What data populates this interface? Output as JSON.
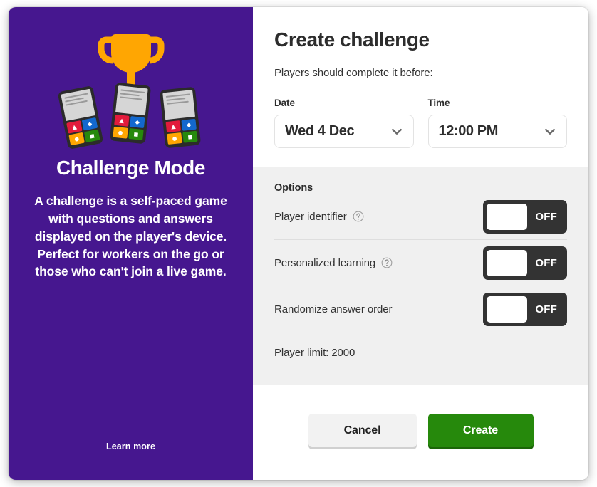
{
  "theme": {
    "purple": "#46178F",
    "green": "#26890c",
    "toggle_dark": "#333333",
    "options_bg": "#f0f0f0",
    "cancel_bg": "#f2f2f2"
  },
  "promo": {
    "title": "Challenge Mode",
    "description": "A challenge is a self-paced game with questions and answers displayed on the player's device. Perfect for workers on the go or those who can't join a live game.",
    "learn_more": "Learn more",
    "illustration": {
      "trophy_icon": "trophy-icon",
      "phone_icons": [
        "phone-icon",
        "phone-icon",
        "phone-icon"
      ],
      "answer_shapes": [
        "triangle",
        "diamond",
        "circle",
        "square"
      ],
      "answer_colors": [
        "#e21b3c",
        "#1368ce",
        "#ffa602",
        "#26890c"
      ]
    }
  },
  "form": {
    "title": "Create challenge",
    "subtitle": "Players should complete it before:",
    "date": {
      "label": "Date",
      "value": "Wed 4 Dec",
      "chevron_icon": "chevron-down-icon"
    },
    "time": {
      "label": "Time",
      "value": "12:00 PM",
      "chevron_icon": "chevron-down-icon"
    }
  },
  "options": {
    "heading": "Options",
    "items": [
      {
        "label": "Player identifier",
        "has_help": true,
        "help_icon": "help-circle-icon",
        "state": "OFF"
      },
      {
        "label": "Personalized learning",
        "has_help": true,
        "help_icon": "help-circle-icon",
        "state": "OFF"
      },
      {
        "label": "Randomize answer order",
        "has_help": false,
        "help_icon": "",
        "state": "OFF"
      }
    ],
    "player_limit": "Player limit: 2000"
  },
  "footer": {
    "cancel_label": "Cancel",
    "create_label": "Create"
  }
}
